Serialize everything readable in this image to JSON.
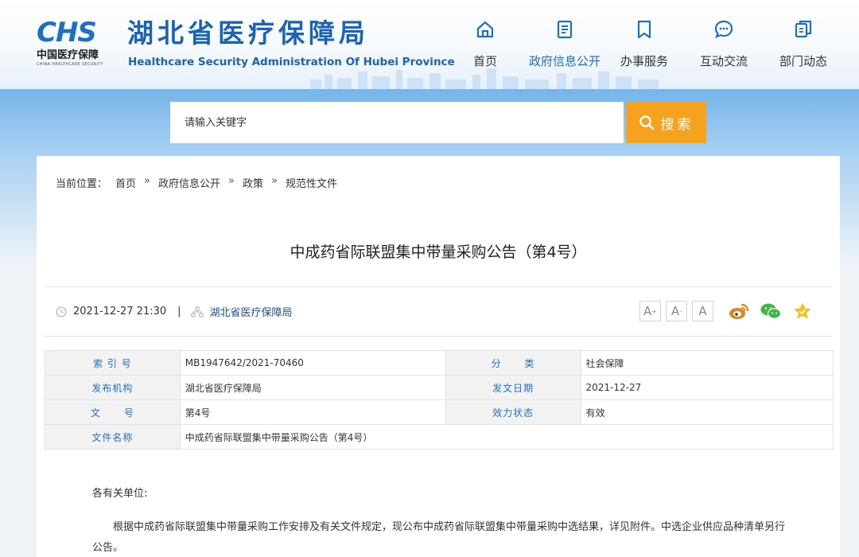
{
  "header": {
    "logo_mark": "CHS",
    "logo_cn": "中国医疗保障",
    "logo_en": "CHINA HEALTHCARE SECURITY",
    "title_cn": "湖北省医疗保障局",
    "title_en": "Healthcare Security Administration Of Hubei Province"
  },
  "nav": [
    {
      "label": "首页",
      "icon": "home-icon"
    },
    {
      "label": "政府信息公开",
      "icon": "document-icon",
      "active": true
    },
    {
      "label": "办事服务",
      "icon": "bookmark-icon"
    },
    {
      "label": "互动交流",
      "icon": "chat-icon"
    },
    {
      "label": "部门动态",
      "icon": "pages-icon"
    }
  ],
  "search": {
    "placeholder": "请输入关键字",
    "button_label": "搜索"
  },
  "breadcrumb": {
    "prefix": "当前位置：",
    "items": [
      "首页",
      "政府信息公开",
      "政策",
      "规范性文件"
    ],
    "separator": "»"
  },
  "article": {
    "title": "中成药省际联盟集中带量采购公告（第4号）",
    "datetime": "2021-12-27 21:30",
    "meta_separator": "|",
    "source": "湖北省医疗保障局"
  },
  "tools": {
    "font_large": "A",
    "font_medium": "A",
    "font_small": "A",
    "font_large_sup": "+",
    "font_medium_sup": "-"
  },
  "info": {
    "index_label": "索 引 号",
    "index_value": "MB1947642/2021-70460",
    "category_label": "分      类",
    "category_value": "社会保障",
    "publisher_label": "发布机构",
    "publisher_value": "湖北省医疗保障局",
    "date_label": "发文日期",
    "date_value": "2021-12-27",
    "docno_label": "文      号",
    "docno_value": "第4号",
    "status_label": "效力状态",
    "status_value": "有效",
    "name_label": "文件名称",
    "name_value": "中成药省际联盟集中带量采购公告（第4号）"
  },
  "body": {
    "salutation": "各有关单位:",
    "paragraph": "根据中成药省际联盟集中带量采购工作安排及有关文件规定，现公布中成药省际联盟集中带量采购中选结果，详见附件。中选企业供应品种清单另行公告。"
  },
  "colors": {
    "brand_blue": "#1f6fc5",
    "search_orange": "#f6a21e",
    "weibo_orange": "#e6821e",
    "wechat_green": "#3fb847",
    "star_yellow": "#f3c221"
  }
}
